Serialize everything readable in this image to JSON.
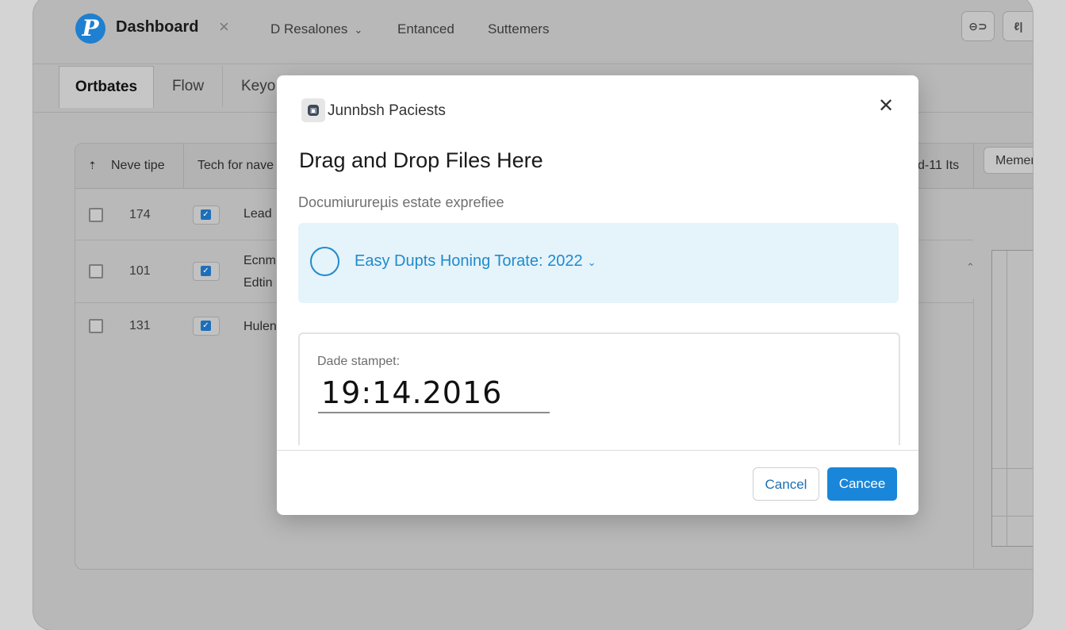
{
  "app": {
    "title": "Dashboard",
    "logo_letter": "P",
    "close_glyph": "×"
  },
  "nav": {
    "items": [
      {
        "label": "D Resalones",
        "has_dropdown": true
      },
      {
        "label": "Entanced"
      },
      {
        "label": "Suttemers"
      }
    ],
    "icon_buttons": [
      {
        "icon": "link-icon",
        "glyph": "⊖⊃"
      },
      {
        "icon": "text-icon",
        "glyph": "ℓ|"
      }
    ]
  },
  "tabs": [
    {
      "label": "Ortbates",
      "active": true
    },
    {
      "label": "Flow"
    },
    {
      "label": "Keyo"
    }
  ],
  "table": {
    "columns": [
      "Neve tipe",
      "Tech for nave"
    ],
    "right_header": "d-11 Its",
    "right_button": "Memer",
    "rows": [
      {
        "num": "174",
        "text": "Lead",
        "checked": true
      },
      {
        "num": "101",
        "text": "Ecnm\nEdtin",
        "checked": true
      },
      {
        "num": "131",
        "text": "Hulen",
        "checked": true
      }
    ]
  },
  "modal": {
    "source": "Junnbsh Paciests",
    "title": "Drag and Drop Files Here",
    "subtitle": "Documiurureµis estate exprefiee",
    "dropzone_text": "Easy Dupts Honing Torate: 2022",
    "stamp_label": "Dade stampet:",
    "stamp_value": "19:14.2016",
    "close_glyph": "✕",
    "cancel_label": "Cancel",
    "primary_label": "Cancee"
  },
  "colors": {
    "accent": "#1a86d9",
    "dropzone_bg": "#e5f3fb",
    "dropzone_text": "#1f8bcb",
    "logo": "#1f7fd0"
  }
}
